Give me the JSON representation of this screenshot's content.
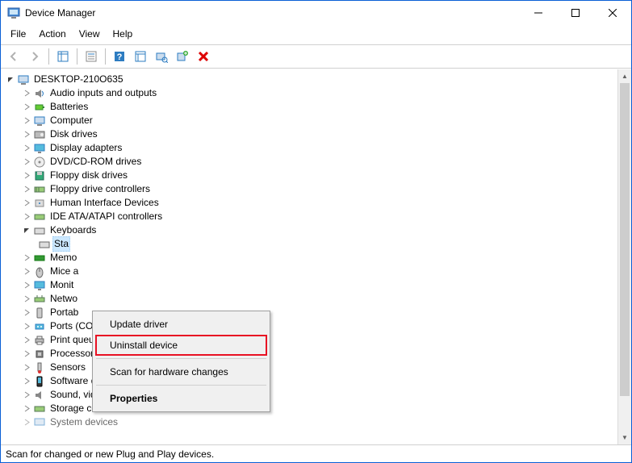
{
  "window": {
    "title": "Device Manager"
  },
  "menubar": [
    "File",
    "Action",
    "View",
    "Help"
  ],
  "toolbar": {
    "back": "back-icon",
    "forward": "forward-icon",
    "up": "up-icon",
    "properties": "properties-icon",
    "help": "help-icon",
    "show_hidden": "show-hidden-icon",
    "scan": "scan-icon",
    "add_legacy": "add-legacy-icon",
    "remove": "remove-icon"
  },
  "tree": {
    "root": "DESKTOP-210O635",
    "categories": [
      "Audio inputs and outputs",
      "Batteries",
      "Computer",
      "Disk drives",
      "Display adapters",
      "DVD/CD-ROM drives",
      "Floppy disk drives",
      "Floppy drive controllers",
      "Human Interface Devices",
      "IDE ATA/ATAPI controllers",
      "Keyboards",
      "Memo",
      "Mice a",
      "Monit",
      "Netwo",
      "Portab",
      "Ports (COM & LPT)",
      "Print queues",
      "Processors",
      "Sensors",
      "Software devices",
      "Sound, video and game controllers",
      "Storage controllers",
      "System devices"
    ],
    "keyboard_child": "Sta"
  },
  "context_menu": {
    "update": "Update driver",
    "uninstall": "Uninstall device",
    "scan": "Scan for hardware changes",
    "properties": "Properties"
  },
  "statusbar": "Scan for changed or new Plug and Play devices."
}
